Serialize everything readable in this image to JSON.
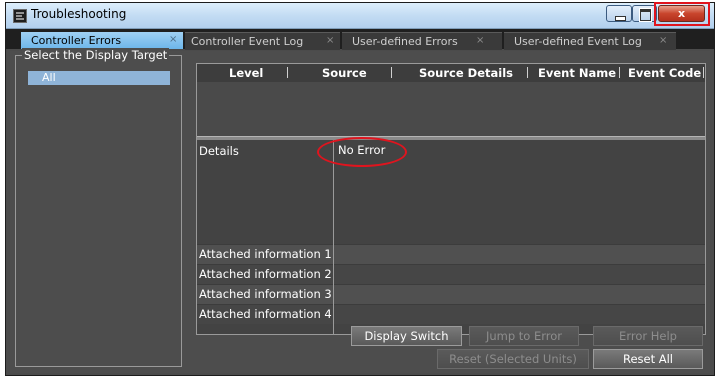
{
  "window": {
    "title": "Troubleshooting",
    "close_symbol": "x"
  },
  "tabs": [
    {
      "label": "Controller Errors",
      "active": true
    },
    {
      "label": "Controller Event Log",
      "active": false
    },
    {
      "label": "User-defined Errors",
      "active": false
    },
    {
      "label": "User-defined Event Log",
      "active": false
    }
  ],
  "tab_close_symbol": "×",
  "display_target": {
    "title": "Select the Display Target",
    "items": [
      "All"
    ]
  },
  "table": {
    "columns": [
      "Level",
      "Source",
      "Source Details",
      "Event Name",
      "Event Code"
    ],
    "rows": []
  },
  "details": {
    "label": "Details",
    "value": "No Error",
    "attached": [
      "Attached information 1",
      "Attached information 2",
      "Attached information 3",
      "Attached information 4"
    ]
  },
  "buttons": {
    "display_switch": "Display Switch",
    "jump_to_error": "Jump to Error",
    "error_help": "Error Help",
    "reset_selected": "Reset (Selected Units)",
    "reset_all": "Reset All"
  },
  "colors": {
    "active_tab": "#6cb6ea",
    "highlight": "#e0141e",
    "panel_bg": "#4d4d4d"
  }
}
